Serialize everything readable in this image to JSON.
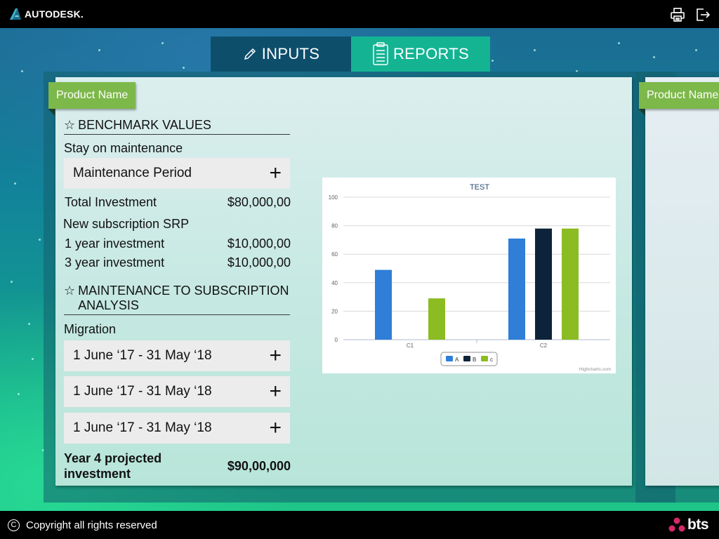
{
  "header": {
    "brand": "AUTODESK.",
    "icons": [
      "print-icon",
      "logout-icon"
    ]
  },
  "tabs": [
    {
      "label": "INPUTS",
      "icon": "pencil-icon",
      "active": false
    },
    {
      "label": "REPORTS",
      "icon": "clipboard-icon",
      "active": true
    }
  ],
  "card": {
    "product_label": "Product Name",
    "benchmark": {
      "title": "BENCHMARK VALUES",
      "stay_label": "Stay on maintenance",
      "maintenance_period": "Maintenance Period",
      "total_investment_label": "Total Investment",
      "total_investment_value": "$80,000,00",
      "new_sub_label": "New subscription SRP",
      "rows": [
        {
          "label": "1 year investment",
          "value": "$10,000,00"
        },
        {
          "label": "3 year investment",
          "value": "$10,000,00"
        }
      ]
    },
    "analysis": {
      "title_line1": "MAINTENANCE TO SUBSCRIPTION",
      "title_line2": "ANALYSIS",
      "migration_label": "Migration",
      "periods": [
        "1 June ‘17 - 31 May ‘18",
        "1 June ‘17 - 31 May ‘18",
        "1 June ‘17 - 31 May ‘18"
      ]
    },
    "year4": {
      "label_line1": "Year 4 projected",
      "label_line2": "investment",
      "value": "$90,00,000"
    }
  },
  "card2": {
    "product_label": "Product Name"
  },
  "chart_data": {
    "type": "bar",
    "title": "TEST",
    "categories": [
      "C1",
      "C2"
    ],
    "series": [
      {
        "name": "A",
        "values": [
          49,
          71
        ],
        "color": "#2f7ed8"
      },
      {
        "name": "B",
        "values": [
          0,
          78
        ],
        "color": "#0d233a"
      },
      {
        "name": "c",
        "values": [
          29,
          78
        ],
        "color": "#8bbc21"
      }
    ],
    "ylim": [
      0,
      100
    ],
    "yticks": [
      0,
      20,
      40,
      60,
      80,
      100
    ],
    "grid": true,
    "legend": "bottom-center",
    "credit": "Highcharts.com"
  },
  "footer": {
    "copyright": "Copyright all rights reserved",
    "company": "bts"
  },
  "colors": {
    "ribbon": "#7db84a",
    "tab_inputs": "#0d4e6b",
    "tab_reports": "#14b493"
  }
}
